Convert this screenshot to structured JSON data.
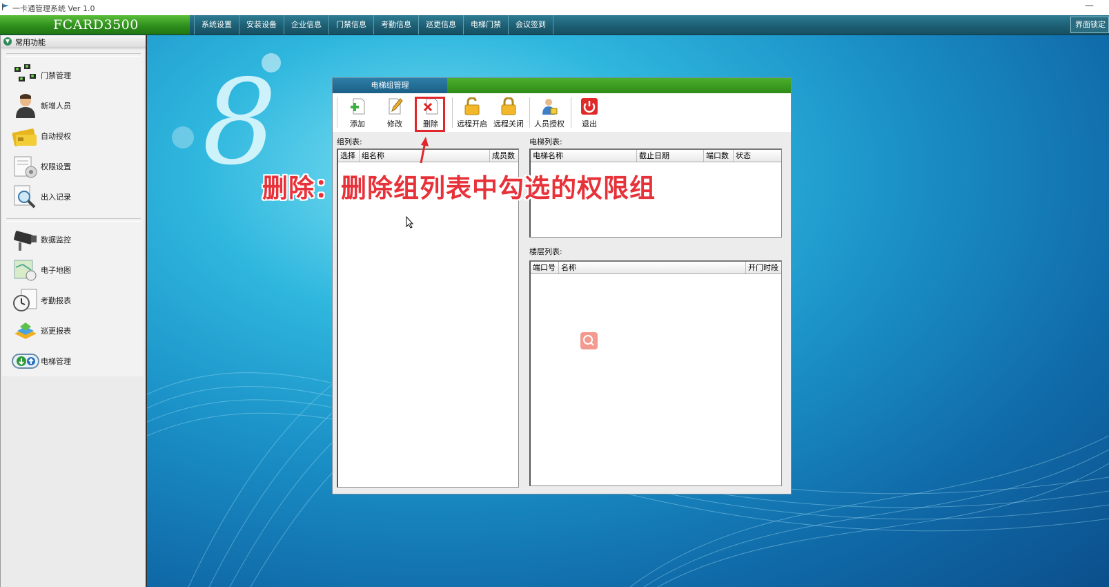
{
  "window": {
    "title": "一卡通管理系统  Ver 1.0",
    "minimize": "—"
  },
  "brand": "FCARD3500",
  "menus": [
    "系统设置",
    "安装设备",
    "企业信息",
    "门禁信息",
    "考勤信息",
    "巡更信息",
    "电梯门禁",
    "会议签到"
  ],
  "lock_label": "界面锁定",
  "sidebar": {
    "header": "常用功能",
    "items": [
      {
        "label": "门禁管理",
        "icon": "door-access-icon"
      },
      {
        "label": "新增人员",
        "icon": "person-icon"
      },
      {
        "label": "自动授权",
        "icon": "card-icon"
      },
      {
        "label": "权限设置",
        "icon": "permission-icon"
      },
      {
        "label": "出入记录",
        "icon": "magnifier-doc-icon"
      },
      {
        "label": "数据监控",
        "icon": "camera-icon"
      },
      {
        "label": "电子地图",
        "icon": "map-icon"
      },
      {
        "label": "考勤报表",
        "icon": "clock-icon"
      },
      {
        "label": "巡更报表",
        "icon": "patrol-icon"
      },
      {
        "label": "电梯管理",
        "icon": "elevator-icon"
      }
    ]
  },
  "dialog": {
    "tab": "电梯组管理",
    "toolbar": [
      {
        "label": "添加",
        "icon": "add-icon"
      },
      {
        "label": "修改",
        "icon": "edit-icon"
      },
      {
        "label": "删除",
        "icon": "delete-icon"
      },
      {
        "label": "远程开启",
        "icon": "unlock-icon"
      },
      {
        "label": "远程关闭",
        "icon": "lock-icon"
      },
      {
        "label": "人员授权",
        "icon": "user-auth-icon"
      },
      {
        "label": "退出",
        "icon": "power-icon"
      }
    ],
    "group_list": {
      "label": "组列表:",
      "columns": [
        "选择",
        "组名称",
        "成员数"
      ]
    },
    "elevator_list": {
      "label": "电梯列表:",
      "columns": [
        "电梯名称",
        "截止日期",
        "端口数",
        "状态"
      ]
    },
    "floor_list": {
      "label": "楼层列表:",
      "columns": [
        "端口号",
        "名称",
        "开门时段"
      ]
    }
  },
  "annotation": "删除：删除组列表中勾选的权限组",
  "colors": {
    "annotation": "#e8323a",
    "highlight": "#e0262a",
    "brand_green": "#2f8f1d",
    "menu_blue": "#1d5f74"
  }
}
